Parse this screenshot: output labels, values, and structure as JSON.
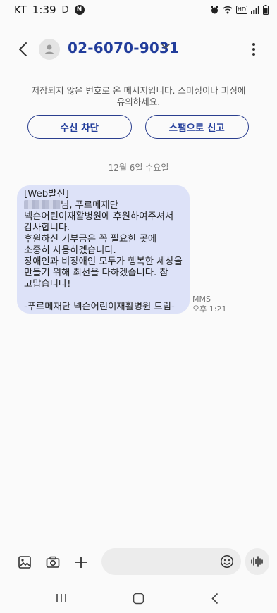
{
  "status_bar": {
    "carrier": "KT",
    "time": "1:39",
    "indicator_d": "D",
    "indicator_n": "N",
    "hd_label": "HD"
  },
  "header": {
    "contact": "02-6070-9031"
  },
  "notice": {
    "line1": "저장되지 않은 번호로 온 메시지입니다. 스미싱이나 피싱에",
    "line2": "유의하세요."
  },
  "actions": {
    "block_label": "수신 차단",
    "report_label": "스팸으로 신고"
  },
  "date_label": "12월 6일 수요일",
  "message": {
    "line1": "[Web발신]",
    "line2_suffix": "님, 푸르메재단",
    "body": "넥슨어린이재활병원에 후원하여주셔서\n감사합니다.\n후원하신 기부금은 꼭 필요한 곳에\n소중히 사용하겠습니다.\n장애인과 비장애인 모두가 행복한 세상을\n만들기 위해 최선을 다하겠습니다. 참\n고맙습니다!\n\n-푸르메재단 넥슨어린이재활병원 드림-",
    "type": "MMS",
    "time": "오후 1:21"
  },
  "composer": {
    "placeholder": ""
  },
  "colors": {
    "accent": "#223d9b",
    "bubble": "#dde2f8",
    "background": "#fafafa"
  },
  "icons": {
    "back": "back-arrow-icon",
    "avatar": "person-icon",
    "more": "more-vertical-icon",
    "gallery": "gallery-icon",
    "camera": "camera-icon",
    "add": "plus-icon",
    "emoji": "emoji-icon",
    "voice": "voice-wave-icon"
  }
}
